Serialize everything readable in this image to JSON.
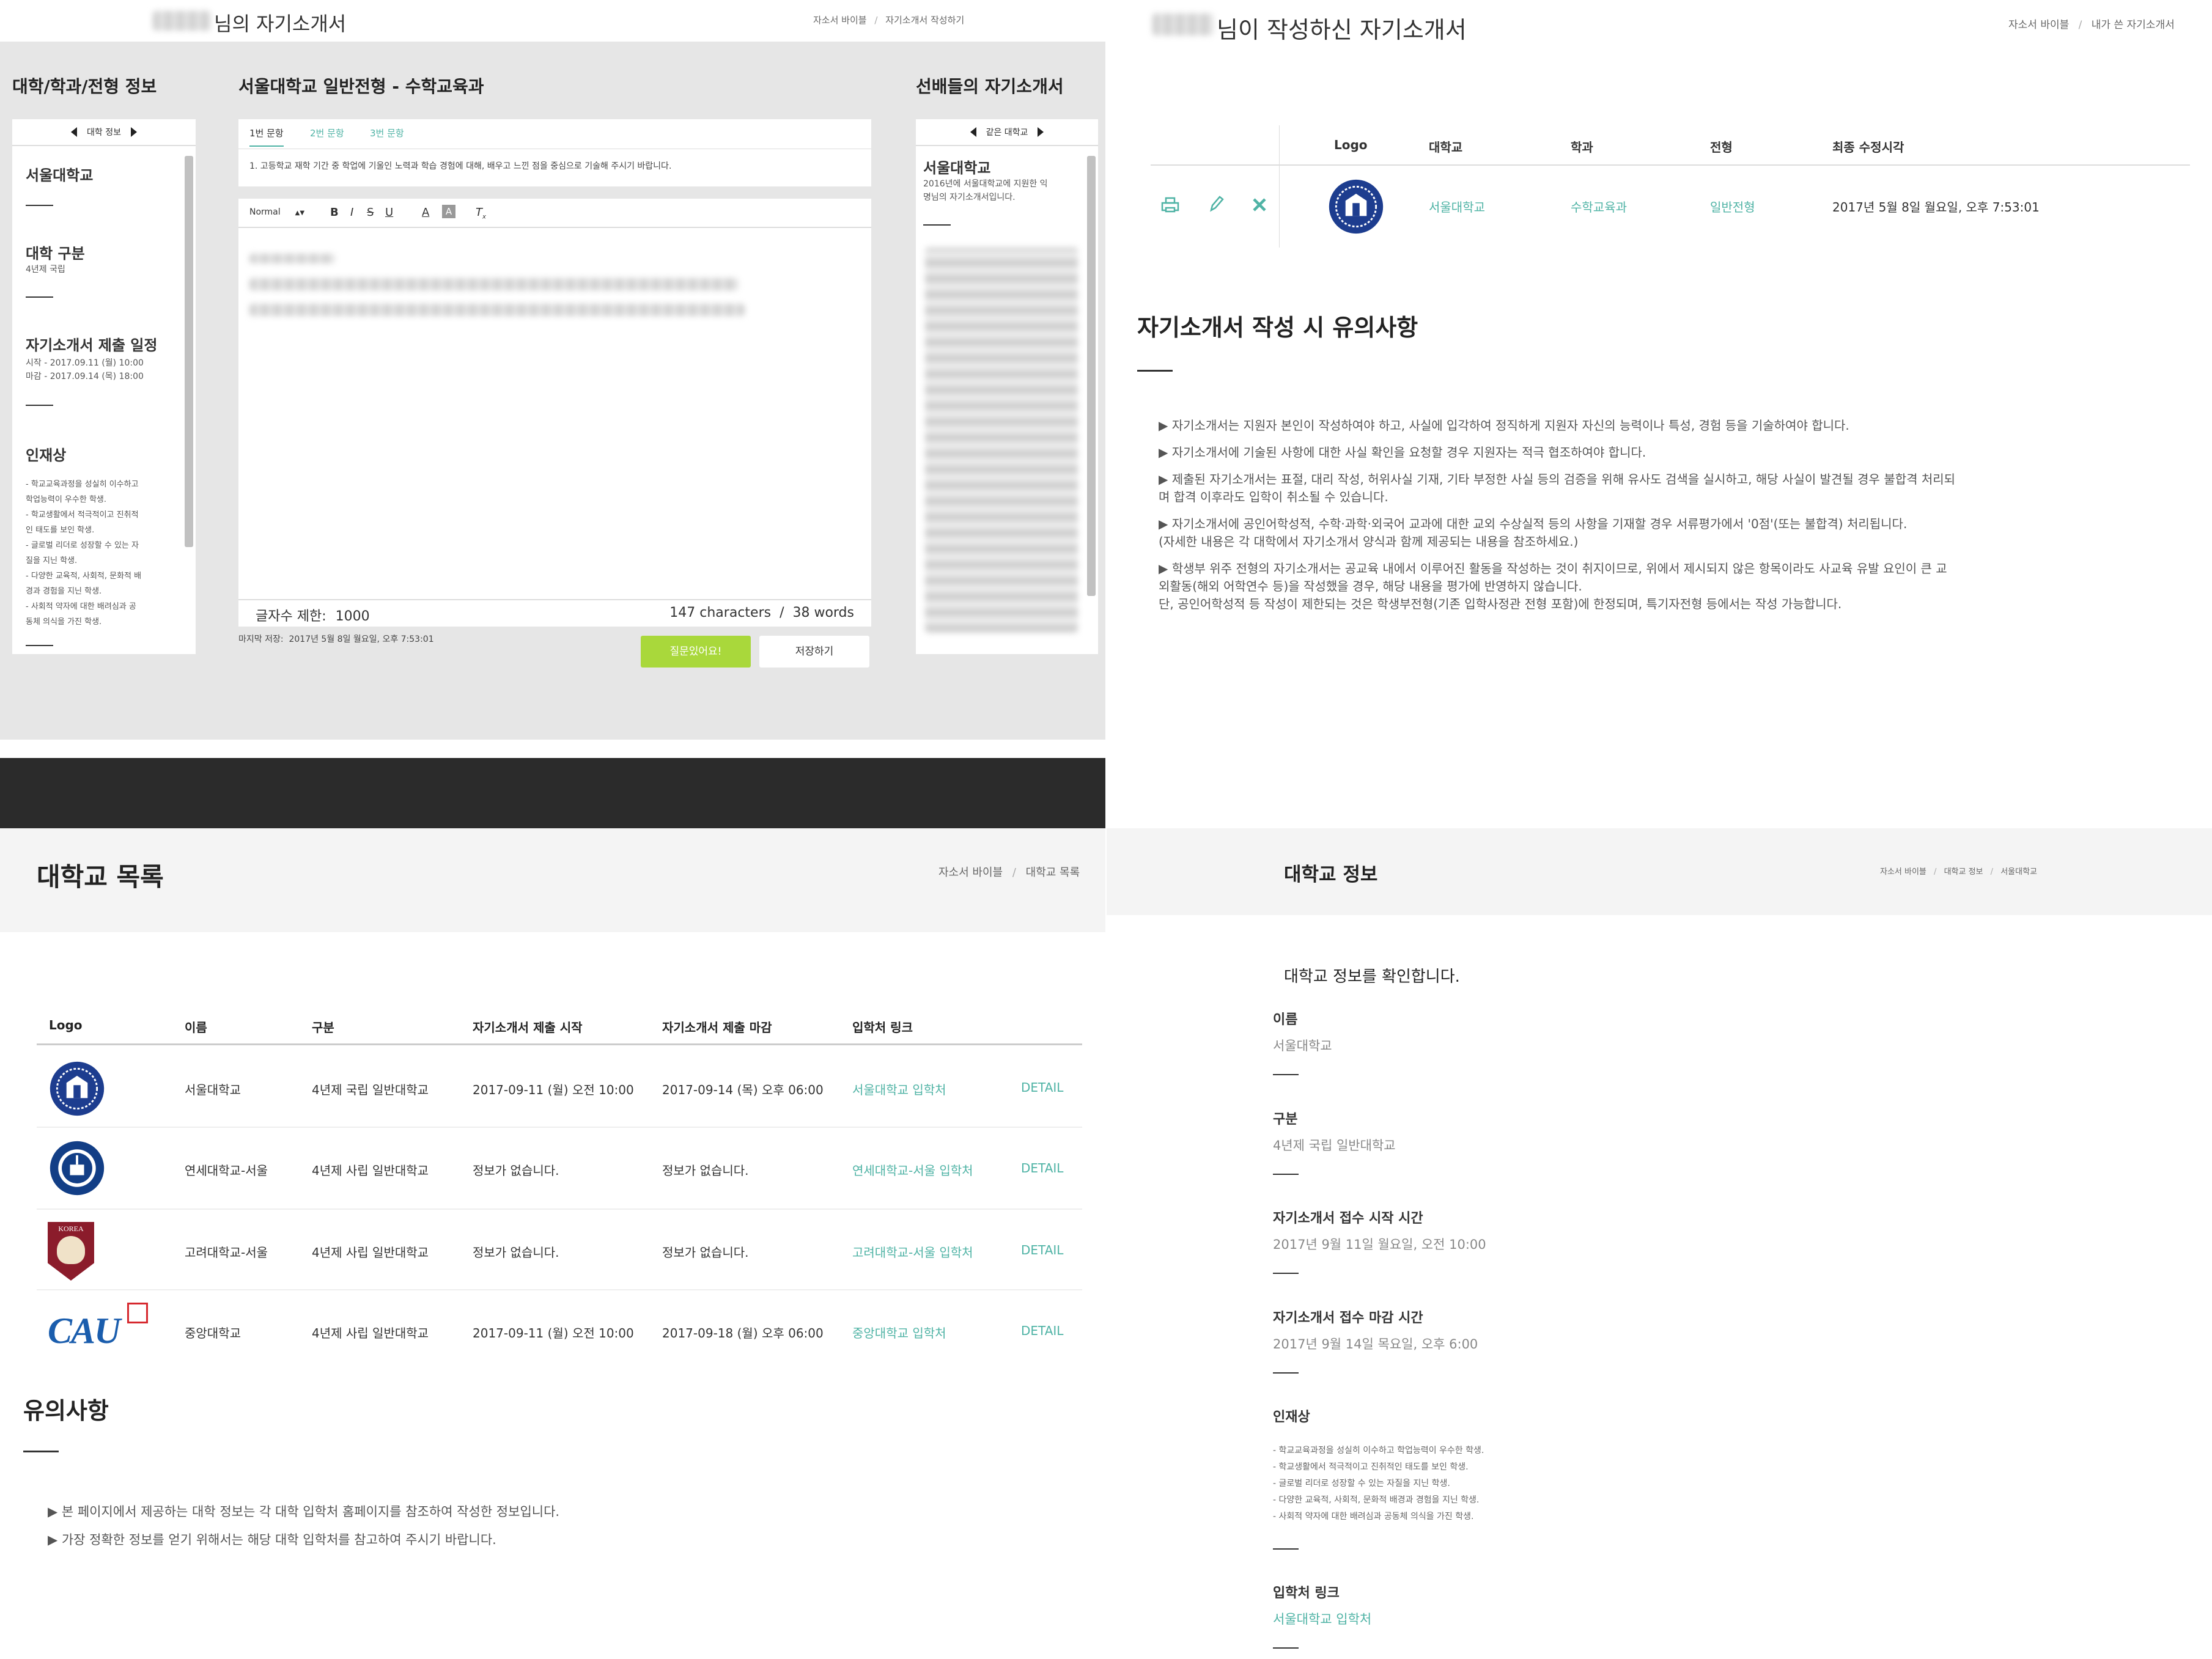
{
  "q1": {
    "title": "님의 자기소개서",
    "breadcrumb": [
      "자소서 바이블",
      "자기소개서 작성하기"
    ],
    "left": {
      "heading": "대학/학과/전형 정보",
      "nav_label": "대학 정보",
      "univ": "서울대학교",
      "type_label": "대학 구분",
      "type_value": "4년제 국립",
      "schedule_label": "자기소개서 제출 일정",
      "schedule_start": "시작 - 2017.09.11 (월) 10:00",
      "schedule_end": "마감 - 2017.09.14 (목) 18:00",
      "talent_label": "인재상",
      "talent": [
        "- 학교교육과정을 성실히 이수하고",
        "학업능력이 우수한 학생.",
        "- 학교생활에서 적극적이고 진취적",
        "인 태도를 보인 학생.",
        "- 글로벌 리더로 성장할 수 있는 자",
        "질을 지닌 학생.",
        "- 다양한 교육적, 사회적, 문화적 배",
        "경과 경험을 지닌 학생.",
        "- 사회적 약자에 대한 배려심과 공",
        "동체 의식을 가진 학생."
      ]
    },
    "center": {
      "heading": "서울대학교 일반전형 - 수학교육과",
      "tabs": [
        "1번 문항",
        "2번 문항",
        "3번 문항"
      ],
      "question": "1. 고등학교 재학 기간 중 학업에 기울인 노력과 학습 경험에 대해, 배우고 느낀 점을 중심으로 기술해 주시기 바랍니다.",
      "format": "Normal",
      "limit_label": "글자수 제한:",
      "limit_value": "1000",
      "count": "147 characters  /  38 words",
      "last_saved": "마지막 저장:  2017년 5월 8일 월요일, 오후 7:53:01",
      "ask_button": "질문있어요!",
      "save_button": "저장하기"
    },
    "right": {
      "heading": "선배들의 자기소개서",
      "nav_label": "같은 대학교",
      "univ": "서울대학교",
      "desc": [
        "2016년에 서울대학교에 지원한 익",
        "명님의 자기소개서입니다."
      ]
    }
  },
  "q2": {
    "title": "님이 작성하신 자기소개서",
    "breadcrumb": [
      "자소서 바이블",
      "내가 쓴 자기소개서"
    ],
    "headers": [
      "Logo",
      "대학교",
      "학과",
      "전형",
      "최종 수정시각"
    ],
    "row": {
      "univ": "서울대학교",
      "dept": "수학교육과",
      "track": "일반전형",
      "time": "2017년 5월 8일 월요일, 오후 7:53:01"
    },
    "notice_title": "자기소개서 작성 시 유의사항",
    "notices": [
      [
        "▶ 자기소개서는 지원자 본인이 작성하여야 하고, 사실에 입각하여 정직하게 지원자 자신의 능력이나 특성, 경험 등을 기술하여야 합니다."
      ],
      [
        "▶ 자기소개서에 기술된 사항에 대한 사실 확인을 요청할 경우 지원자는 적극 협조하여야 합니다."
      ],
      [
        "▶ 제출된 자기소개서는 표절, 대리 작성, 허위사실 기재, 기타 부정한 사실 등의 검증을 위해 유사도 검색을 실시하고, 해당 사실이 발견될 경우 불합격 처리되",
        "며 합격 이후라도 입학이 취소될 수 있습니다."
      ],
      [
        "▶ 자기소개서에 공인어학성적, 수학·과학·외국어 교과에 대한 교외 수상실적 등의 사항을 기재할 경우 서류평가에서 '0점'(또는 불합격) 처리됩니다.",
        "(자세한 내용은 각 대학에서 자기소개서 양식과 함께 제공되는 내용을 참조하세요.)"
      ],
      [
        "▶ 학생부 위주 전형의 자기소개서는 공교육 내에서 이루어진 활동을 작성하는 것이 취지이므로, 위에서 제시되지 않은 항목이라도 사교육 유발 요인이 큰 교",
        "외활동(해외 어학연수 등)을 작성했을 경우, 해당 내용을 평가에 반영하지 않습니다.",
        "단, 공인어학성적 등 작성이 제한되는 것은 학생부전형(기존 입학사정관 전형 포함)에 한정되며, 특기자전형 등에서는 작성 가능합니다."
      ]
    ]
  },
  "q3": {
    "title": "대학교 목록",
    "breadcrumb": [
      "자소서 바이블",
      "대학교 목록"
    ],
    "headers": [
      "Logo",
      "이름",
      "구분",
      "자기소개서 제출 시작",
      "자기소개서 제출 마감",
      "입학처 링크"
    ],
    "rows": [
      {
        "name": "서울대학교",
        "type": "4년제 국립 일반대학교",
        "start": "2017-09-11 (월) 오전 10:00",
        "end": "2017-09-14 (목) 오후 06:00",
        "link": "서울대학교 입학처",
        "detail": "DETAIL"
      },
      {
        "name": "연세대학교-서울",
        "type": "4년제 사립 일반대학교",
        "start": "정보가 없습니다.",
        "end": "정보가 없습니다.",
        "link": "연세대학교-서울 입학처",
        "detail": "DETAIL"
      },
      {
        "name": "고려대학교-서울",
        "type": "4년제 사립 일반대학교",
        "start": "정보가 없습니다.",
        "end": "정보가 없습니다.",
        "link": "고려대학교-서울 입학처",
        "detail": "DETAIL"
      },
      {
        "name": "중앙대학교",
        "type": "4년제 사립 일반대학교",
        "start": "2017-09-11 (월) 오전 10:00",
        "end": "2017-09-18 (월) 오후 06:00",
        "link": "중앙대학교 입학처",
        "detail": "DETAIL"
      }
    ],
    "logo_text": {
      "korea": "KOREA",
      "cau": "CAU"
    },
    "notice_title": "유의사항",
    "notices": [
      "▶ 본 페이지에서 제공하는 대학 정보는 각 대학 입학처 홈페이지를 참조하여 작성한 정보입니다.",
      "▶ 가장 정확한 정보를 얻기 위해서는 해당 대학 입학처를 참고하여 주시기 바랍니다."
    ]
  },
  "q4": {
    "title": "대학교 정보",
    "breadcrumb": [
      "자소서 바이블",
      "대학교 정보",
      "서울대학교"
    ],
    "intro": "대학교 정보를 확인합니다.",
    "name_label": "이름",
    "name_value": "서울대학교",
    "type_label": "구분",
    "type_value": "4년제 국립 일반대학교",
    "start_label": "자기소개서 접수 시작 시간",
    "start_value": "2017년 9월 11일 월요일, 오전 10:00",
    "end_label": "자기소개서 접수 마감 시간",
    "end_value": "2017년 9월 14일 목요일, 오후 6:00",
    "talent_label": "인재상",
    "talent": [
      "- 학교교육과정을 성실히 이수하고 학업능력이 우수한 학생.",
      "- 학교생활에서 적극적이고 진취적인 태도를 보인 학생.",
      "- 글로벌 리더로 성장할 수 있는 자질을 지닌 학생.",
      "- 다양한 교육적, 사회적, 문화적 배경과 경험을 지닌 학생.",
      "- 사회적 약자에 대한 배려심과 공동체 의식을 가진 학생."
    ],
    "link_label": "입학처 링크",
    "link_value": "서울대학교 입학처"
  }
}
